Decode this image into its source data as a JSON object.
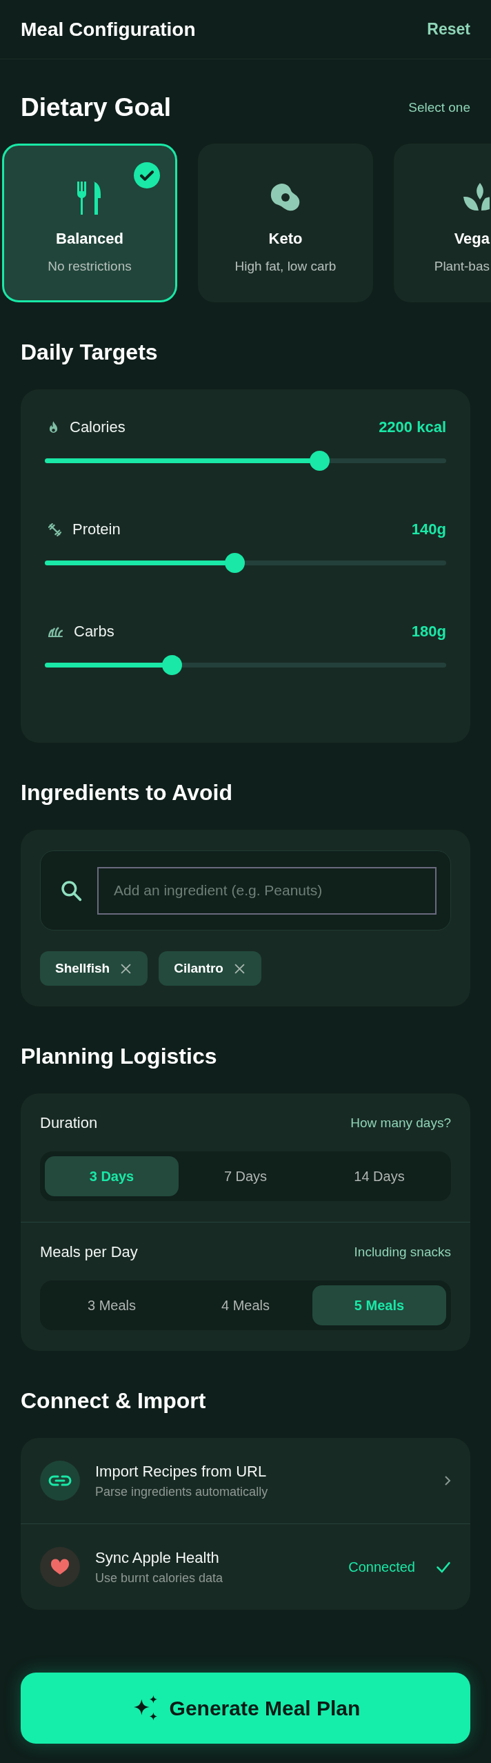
{
  "header": {
    "title": "Meal Configuration",
    "action": "Reset"
  },
  "dietary_goal": {
    "title": "Dietary Goal",
    "hint": "Select one",
    "options": [
      {
        "label": "Balanced",
        "description": "No restrictions",
        "selected": true
      },
      {
        "label": "Keto",
        "description": "High fat, low carb",
        "selected": false
      },
      {
        "label": "Vega",
        "description": "Plant-bas",
        "selected": false
      }
    ]
  },
  "daily_targets": {
    "title": "Daily Targets",
    "targets": [
      {
        "label": "Calories",
        "reading": "2200 kcal",
        "level": 0.65
      },
      {
        "label": "Protein",
        "reading": "140g",
        "level": 0.45
      },
      {
        "label": "Carbs",
        "reading": "180g",
        "level": 0.3
      }
    ]
  },
  "ingredients_to_avoid": {
    "title": "Ingredients to Avoid",
    "search": {
      "placeholder": "Add an ingredient (e.g. Peanuts)"
    },
    "tags": [
      "Shellfish",
      "Cilantro"
    ]
  },
  "planning_logistics": {
    "title": "Planning Logistics",
    "groups": [
      {
        "label": "Duration",
        "hint": "How many days?",
        "options": [
          {
            "label": "3 Days",
            "selected": true
          },
          {
            "label": "7 Days",
            "selected": false
          },
          {
            "label": "14 Days",
            "selected": false
          }
        ]
      },
      {
        "label": "Meals per Day",
        "hint": "Including snacks",
        "options": [
          {
            "label": "3 Meals",
            "selected": false
          },
          {
            "label": "4 Meals",
            "selected": false
          },
          {
            "label": "5 Meals",
            "selected": true
          }
        ]
      }
    ]
  },
  "connect_import": {
    "title": "Connect & Import",
    "items": [
      {
        "title": "Import Recipes from URL",
        "subtitle": "Parse ingredients automatically",
        "connected": false
      },
      {
        "title": "Sync Apple Health",
        "subtitle": "Use burnt calories data",
        "connected": true,
        "status": "Connected"
      }
    ]
  },
  "generate_button": {
    "label": "Generate Meal Plan"
  }
}
